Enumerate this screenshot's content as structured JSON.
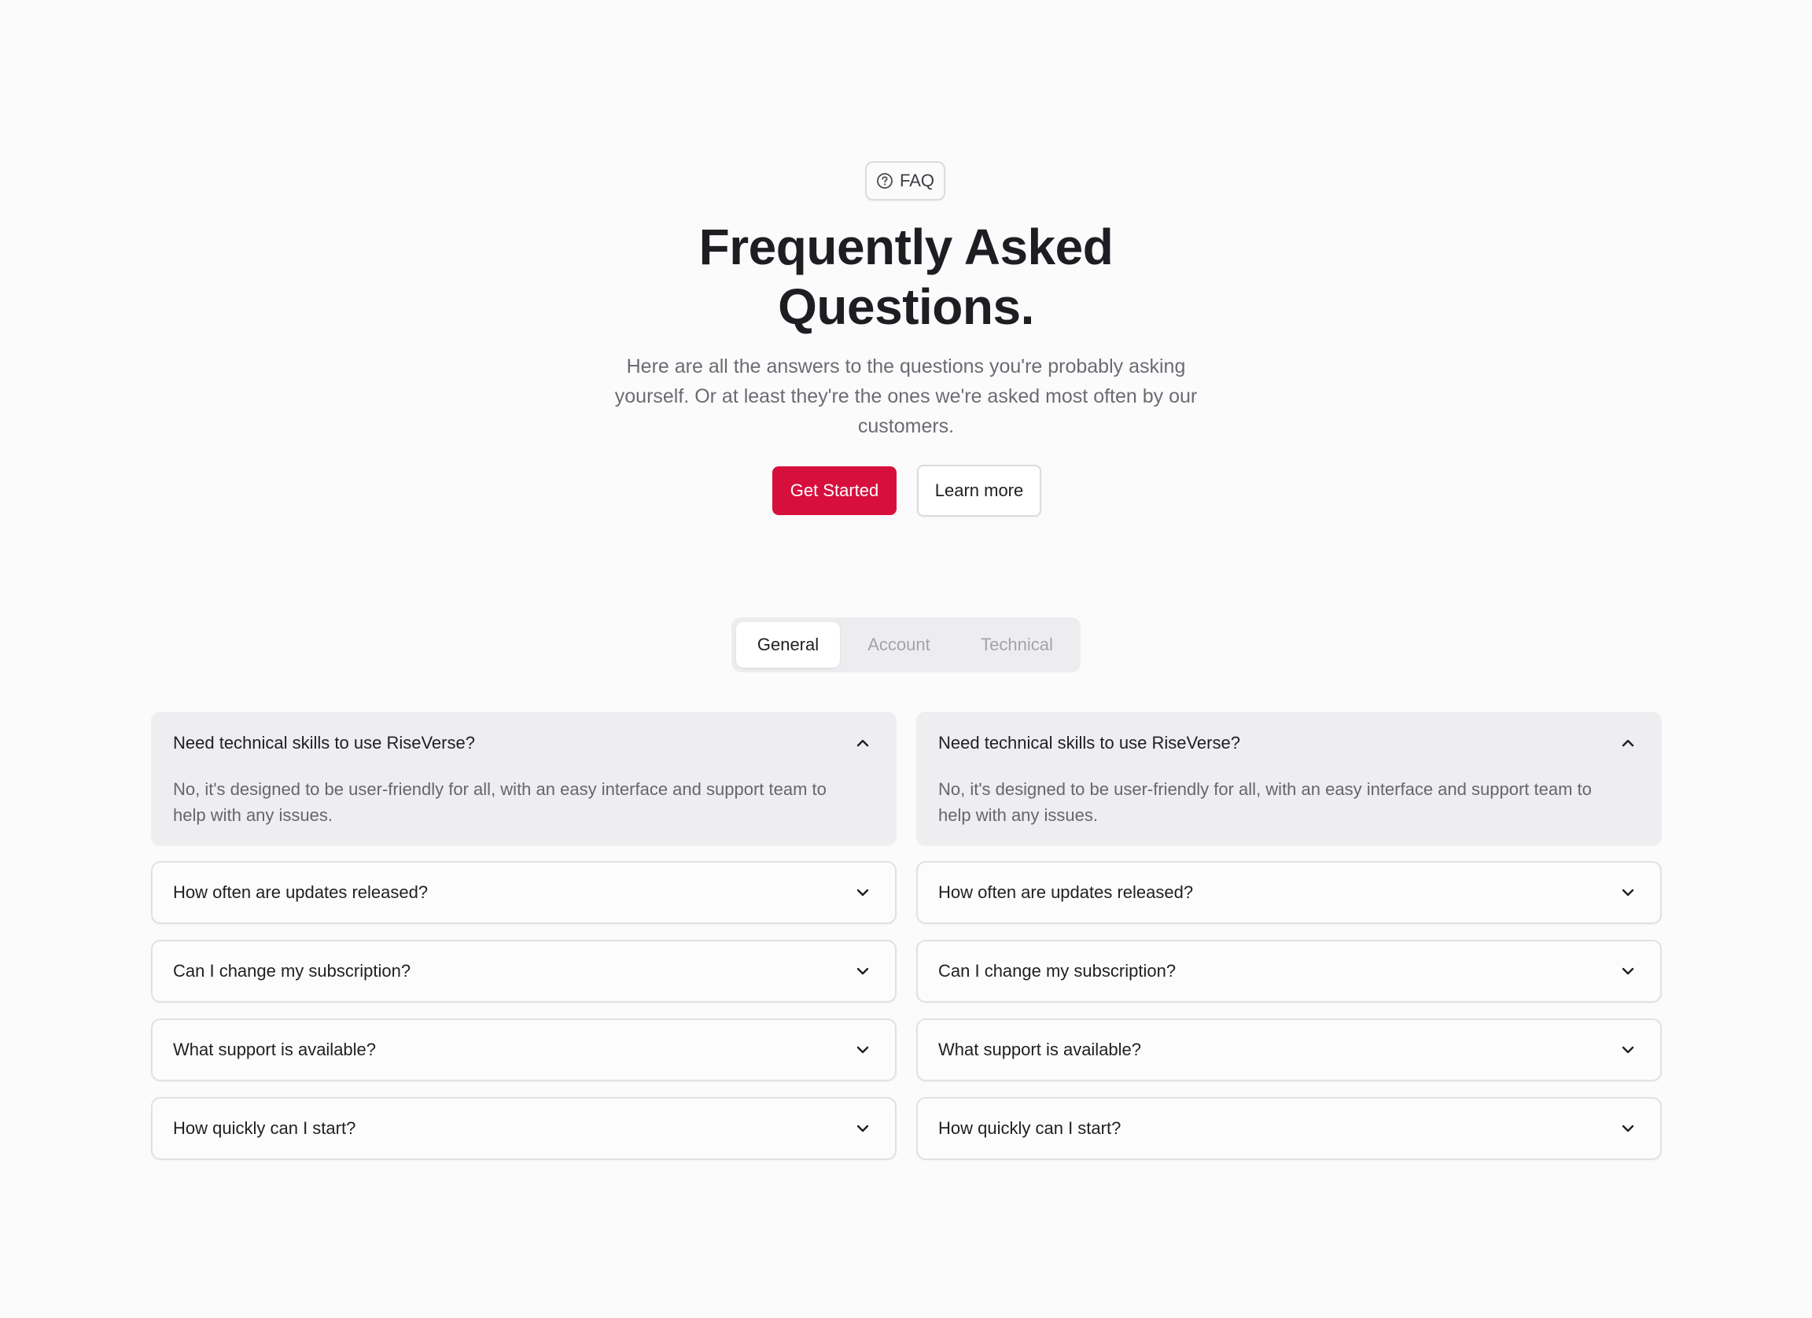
{
  "badge": {
    "label": "FAQ",
    "icon": "question-circle-icon"
  },
  "title": {
    "line1": "Frequently Asked",
    "line2": "Questions."
  },
  "subtitle": {
    "line1": "Here are all the answers to the questions you're probably asking",
    "line2": "yourself. Or at least they're the ones we're asked most often by our",
    "line3": "customers."
  },
  "actions": {
    "primary_label": "Get Started",
    "secondary_label": "Learn more"
  },
  "tabs": [
    {
      "label": "General",
      "active": true
    },
    {
      "label": "Account",
      "active": false
    },
    {
      "label": "Technical",
      "active": false
    }
  ],
  "colors": {
    "accent": "#d70f3c",
    "background": "#fcfbfc",
    "open_item_bg": "#eeedef"
  },
  "faq": {
    "left": [
      {
        "question": "Need technical skills to use RiseVerse?",
        "answer_line1": "No, it's designed to be user-friendly for all, with an easy interface and support team to",
        "answer_line2": "help with any issues.",
        "open": true
      },
      {
        "question": "How often are updates released?",
        "open": false
      },
      {
        "question": "Can I change my subscription?",
        "open": false
      },
      {
        "question": "What support is available?",
        "open": false
      },
      {
        "question": "How quickly can I start?",
        "open": false
      }
    ],
    "right": [
      {
        "question": "Need technical skills to use RiseVerse?",
        "answer_line1": "No, it's designed to be user-friendly for all, with an easy interface and support team to",
        "answer_line2": "help with any issues.",
        "open": true
      },
      {
        "question": "How often are updates released?",
        "open": false
      },
      {
        "question": "Can I change my subscription?",
        "open": false
      },
      {
        "question": "What support is available?",
        "open": false
      },
      {
        "question": "How quickly can I start?",
        "open": false
      }
    ]
  }
}
